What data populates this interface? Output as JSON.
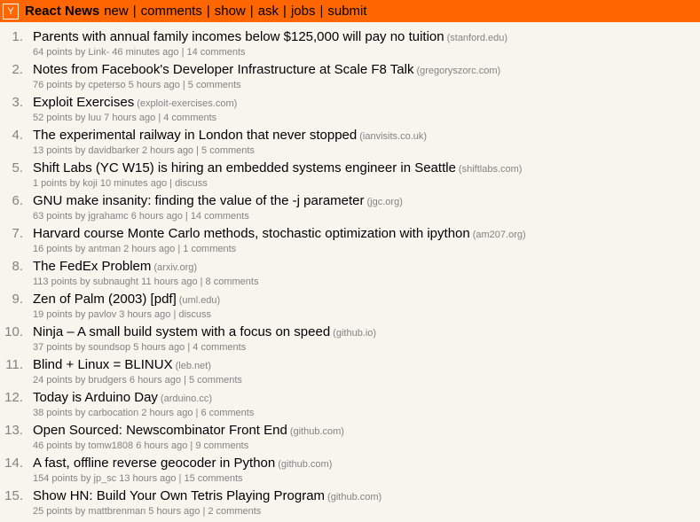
{
  "header": {
    "logo_letter": "Y",
    "site_title": "React News",
    "nav": [
      "new",
      "comments",
      "show",
      "ask",
      "jobs",
      "submit"
    ],
    "separator": "|",
    "background": "#ff6600"
  },
  "items": [
    {
      "rank": "1.",
      "title": "Parents with annual family incomes below $125,000 will pay no tuition",
      "domain": "(stanford.edu)",
      "points": "64 points",
      "by": "by",
      "user": "Link-",
      "age": "46 minutes ago",
      "sep": "|",
      "comments": "14 comments"
    },
    {
      "rank": "2.",
      "title": "Notes from Facebook's Developer Infrastructure at Scale F8 Talk",
      "domain": "(gregoryszorc.com)",
      "points": "76 points",
      "by": "by",
      "user": "cpeterso",
      "age": "5 hours ago",
      "sep": "|",
      "comments": "5 comments"
    },
    {
      "rank": "3.",
      "title": "Exploit Exercises",
      "domain": "(exploit-exercises.com)",
      "points": "52 points",
      "by": "by",
      "user": "luu",
      "age": "7 hours ago",
      "sep": "|",
      "comments": "4 comments"
    },
    {
      "rank": "4.",
      "title": "The experimental railway in London that never stopped",
      "domain": "(ianvisits.co.uk)",
      "points": "13 points",
      "by": "by",
      "user": "davidbarker",
      "age": "2 hours ago",
      "sep": "|",
      "comments": "5 comments"
    },
    {
      "rank": "5.",
      "title": "Shift Labs (YC W15) is hiring an embedded systems engineer in Seattle",
      "domain": "(shiftlabs.com)",
      "points": "1 points",
      "by": "by",
      "user": "koji",
      "age": "10 minutes ago",
      "sep": "|",
      "comments": "discuss"
    },
    {
      "rank": "6.",
      "title": "GNU make insanity: finding the value of the -j parameter",
      "domain": "(jgc.org)",
      "points": "63 points",
      "by": "by",
      "user": "jgrahamc",
      "age": "6 hours ago",
      "sep": "|",
      "comments": "14 comments"
    },
    {
      "rank": "7.",
      "title": "Harvard course Monte Carlo methods, stochastic optimization with ipython",
      "domain": "(am207.org)",
      "points": "16 points",
      "by": "by",
      "user": "antman",
      "age": "2 hours ago",
      "sep": "|",
      "comments": "1 comments"
    },
    {
      "rank": "8.",
      "title": "The FedEx Problem",
      "domain": "(arxiv.org)",
      "points": "113 points",
      "by": "by",
      "user": "subnaught",
      "age": "11 hours ago",
      "sep": "|",
      "comments": "8 comments"
    },
    {
      "rank": "9.",
      "title": "Zen of Palm (2003) [pdf]",
      "domain": "(uml.edu)",
      "points": "19 points",
      "by": "by",
      "user": "pavlov",
      "age": "3 hours ago",
      "sep": "|",
      "comments": "discuss"
    },
    {
      "rank": "10.",
      "title": "Ninja – A small build system with a focus on speed",
      "domain": "(github.io)",
      "points": "37 points",
      "by": "by",
      "user": "soundsop",
      "age": "5 hours ago",
      "sep": "|",
      "comments": "4 comments"
    },
    {
      "rank": "11.",
      "title": "Blind + Linux = BLINUX",
      "domain": "(leb.net)",
      "points": "24 points",
      "by": "by",
      "user": "brudgers",
      "age": "6 hours ago",
      "sep": "|",
      "comments": "5 comments"
    },
    {
      "rank": "12.",
      "title": "Today is Arduino Day",
      "domain": "(arduino.cc)",
      "points": "38 points",
      "by": "by",
      "user": "carbocation",
      "age": "2 hours ago",
      "sep": "|",
      "comments": "6 comments"
    },
    {
      "rank": "13.",
      "title": "Open Sourced: Newscombinator Front End",
      "domain": "(github.com)",
      "points": "46 points",
      "by": "by",
      "user": "tomw1808",
      "age": "6 hours ago",
      "sep": "|",
      "comments": "9 comments"
    },
    {
      "rank": "14.",
      "title": "A fast, offline reverse geocoder in Python",
      "domain": "(github.com)",
      "points": "154 points",
      "by": "by",
      "user": "jp_sc",
      "age": "13 hours ago",
      "sep": "|",
      "comments": "15 comments"
    },
    {
      "rank": "15.",
      "title": "Show HN: Build Your Own Tetris Playing Program",
      "domain": "(github.com)",
      "points": "25 points",
      "by": "by",
      "user": "mattbrenman",
      "age": "5 hours ago",
      "sep": "|",
      "comments": "2 comments"
    }
  ]
}
